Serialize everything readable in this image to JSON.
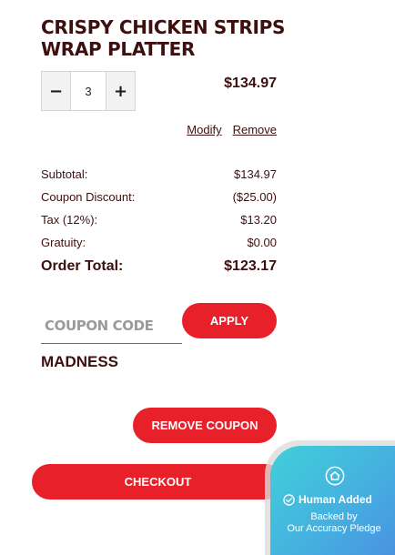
{
  "item": {
    "name": "CRISPY CHICKEN STRIPS WRAP PLATTER",
    "quantity": "3",
    "price": "$134.97",
    "decrement_label": "−",
    "increment_label": "+",
    "modify_label": "Modify",
    "remove_label": "Remove"
  },
  "summary": {
    "subtotal_label": "Subtotal:",
    "subtotal_value": "$134.97",
    "discount_label": "Coupon Discount:",
    "discount_value": "($25.00)",
    "tax_label": "Tax (12%):",
    "tax_value": "$13.20",
    "gratuity_label": "Gratuity:",
    "gratuity_value": "$0.00",
    "total_label": "Order Total:",
    "total_value": "$123.17"
  },
  "coupon": {
    "placeholder": "COUPON CODE",
    "apply_label": "APPLY",
    "applied_code": "MADNESS",
    "remove_label": "REMOVE COUPON"
  },
  "checkout": {
    "label": "CHECKOUT"
  },
  "badge": {
    "title": "Human Added",
    "line1": "Backed by",
    "line2": "Our Accuracy Pledge",
    "icon": "house-icon",
    "check_icon": "check-circle-icon"
  },
  "colors": {
    "brand_red": "#e8202a",
    "text_dark": "#3d0f0f",
    "badge_teal": "#3fd0d8",
    "badge_blue": "#4a8fe0"
  }
}
